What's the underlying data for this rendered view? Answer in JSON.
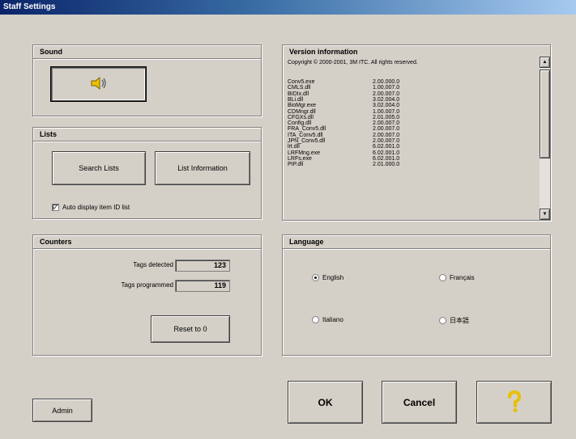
{
  "window": {
    "title": "Staff Settings"
  },
  "sound": {
    "title": "Sound",
    "button_icon": "speaker-icon"
  },
  "lists": {
    "title": "Lists",
    "search_lists_label": "Search Lists",
    "list_information_label": "List Information",
    "auto_display_label": "Auto display item ID list",
    "auto_display_checked": true
  },
  "counters": {
    "title": "Counters",
    "tags_detected_label": "Tags detected",
    "tags_detected_value": "123",
    "tags_programmed_label": "Tags programmed",
    "tags_programmed_value": "119",
    "reset_label": "Reset to 0"
  },
  "version": {
    "title": "Version information",
    "copyright": "Copyright © 2000-2001, 3M ITC. All rights reserved.",
    "rows": [
      {
        "name": "Conv5.exe",
        "ver": "2.00.000.0"
      },
      {
        "name": "CMLS.dll",
        "ver": "1.00.007.0"
      },
      {
        "name": "BIDIx.dll",
        "ver": "2.00.007.0"
      },
      {
        "name": "BLi.dll",
        "ver": "3.02.004.0"
      },
      {
        "name": "BioMgr.exe",
        "ver": "3.02.004.0"
      },
      {
        "name": "CDMngr.dll",
        "ver": "1.00.007.0"
      },
      {
        "name": "CFGXs.dll",
        "ver": "2.01.005.0"
      },
      {
        "name": "Config.dll",
        "ver": "2.00.007.0"
      },
      {
        "name": "FRA_Conv5.dll",
        "ver": "2.00.007.0"
      },
      {
        "name": "ITA_Conv5.dll",
        "ver": "2.00.007.0"
      },
      {
        "name": "JPN_Conv5.dll",
        "ver": "2.00.007.0"
      },
      {
        "name": "lrt.dll",
        "ver": "6.02.001.0"
      },
      {
        "name": "LRFMng.exe",
        "ver": "6.02.001.0"
      },
      {
        "name": "LRFs.exe",
        "ver": "6.02.001.0"
      },
      {
        "name": "PIP.dll",
        "ver": "2.01.000.0"
      }
    ]
  },
  "language": {
    "title": "Language",
    "options": [
      {
        "label": "English",
        "selected": true
      },
      {
        "label": "Français",
        "selected": false
      },
      {
        "label": "Italiano",
        "selected": false
      },
      {
        "label": "日本語",
        "selected": false
      }
    ]
  },
  "footer": {
    "admin_label": "Admin",
    "ok_label": "OK",
    "cancel_label": "Cancel",
    "help_icon": "question-mark-icon"
  },
  "colors": {
    "titlebar_start": "#0a246a",
    "titlebar_end": "#a6caf0",
    "face": "#d4d0c8",
    "help_yellow": "#e8c000"
  }
}
